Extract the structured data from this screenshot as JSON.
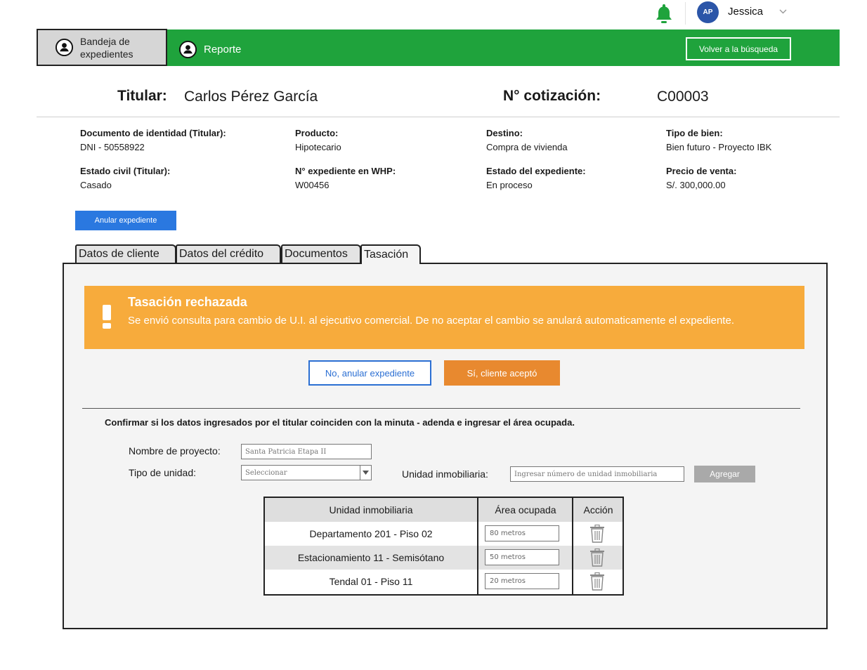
{
  "user": {
    "initials": "AP",
    "name": "Jessica"
  },
  "nav": {
    "inbox_label": "Bandeja de expedientes",
    "report_label": "Reporte",
    "back_button": "Volver a la búsqueda"
  },
  "header": {
    "titular_label": "Titular:",
    "titular_value": "Carlos Pérez García",
    "cotizacion_label": "N° cotización:",
    "cotizacion_value": "C00003"
  },
  "info": [
    {
      "label": "Documento de identidad (Titular):",
      "value": "DNI - 50558922"
    },
    {
      "label": "Producto:",
      "value": "Hipotecario"
    },
    {
      "label": "Destino:",
      "value": "Compra de vivienda"
    },
    {
      "label": "Tipo de bien:",
      "value": "Bien futuro - Proyecto IBK"
    },
    {
      "label": "Estado civil (Titular):",
      "value": "Casado"
    },
    {
      "label": "N° expediente en WHP:",
      "value": "W00456"
    },
    {
      "label": "Estado del expediente:",
      "value": "En proceso"
    },
    {
      "label": "Precio de venta:",
      "value": "S/. 300,000.00"
    }
  ],
  "anular_button": "Anular expediente",
  "tabs": [
    "Datos de cliente",
    "Datos del crédito",
    "Documentos",
    "Tasación"
  ],
  "alert": {
    "title": "Tasación rechazada",
    "message": "Se envió consulta para cambio de U.I. al ejecutivo comercial. De no aceptar el cambio se anulará automaticamente el expediente."
  },
  "actions": {
    "no_label": "No, anular expediente",
    "si_label": "Sí, cliente aceptó"
  },
  "instruction": "Confirmar si los datos ingresados por el titular coinciden con la minuta - adenda e ingresar el área ocupada.",
  "form": {
    "proyecto_label": "Nombre de proyecto:",
    "proyecto_value": "Santa Patricia Etapa II",
    "tipo_label": "Tipo de unidad:",
    "tipo_value": "Seleccionar",
    "unidad_label": "Unidad inmobiliaria:",
    "unidad_placeholder": "Ingresar número de unidad inmobiliaria",
    "agregar_label": "Agregar"
  },
  "table": {
    "headers": [
      "Unidad inmobiliaria",
      "Área ocupada",
      "Acción"
    ],
    "rows": [
      {
        "unidad": "Departamento 201 - Piso 02",
        "area": "80 metros"
      },
      {
        "unidad": "Estacionamiento 11 - Semisótano",
        "area": "50 metros"
      },
      {
        "unidad": "Tendal 01 - Piso 11",
        "area": "20 metros"
      }
    ]
  },
  "colors": {
    "header_green": "#1fa33c",
    "alert_orange": "#f7ab3c",
    "accept_orange": "#e8892f",
    "primary_blue": "#2a78e0"
  }
}
